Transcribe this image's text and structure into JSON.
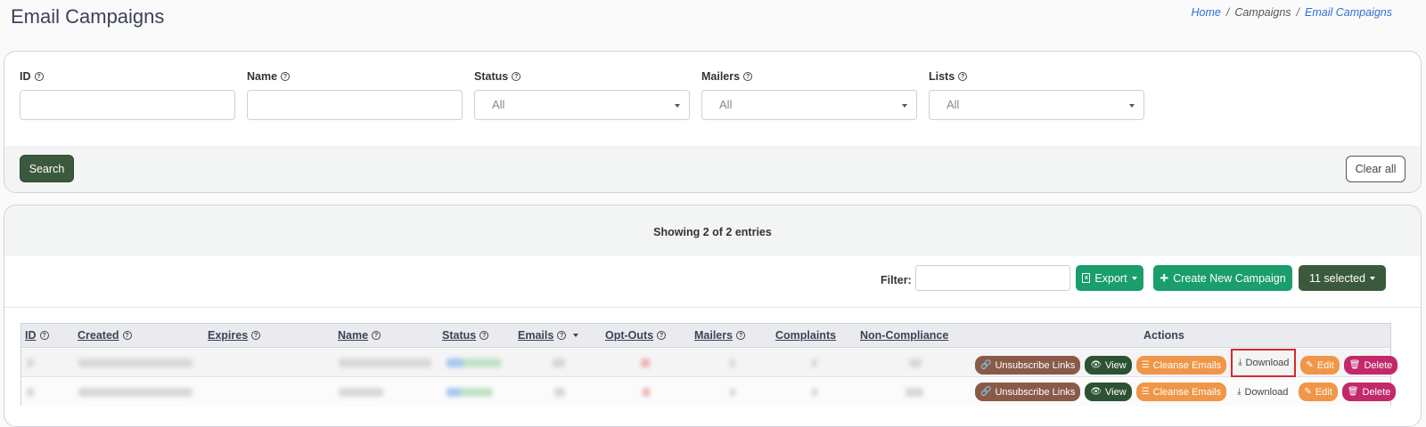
{
  "page": {
    "title": "Email Campaigns",
    "breadcrumb": [
      "Home",
      "Campaigns",
      "Email Campaigns"
    ]
  },
  "filters": {
    "fields": [
      {
        "label": "ID",
        "type": "text",
        "value": ""
      },
      {
        "label": "Name",
        "type": "text",
        "value": ""
      },
      {
        "label": "Status",
        "type": "select",
        "value": "All"
      },
      {
        "label": "Mailers",
        "type": "select",
        "value": "All"
      },
      {
        "label": "Lists",
        "type": "select",
        "value": "All"
      }
    ],
    "search_label": "Search",
    "clear_label": "Clear all"
  },
  "results": {
    "summary": "Showing 2 of 2 entries",
    "filter_label": "Filter:",
    "export_label": "Export",
    "create_label": "Create New Campaign",
    "selected_label": "11 selected",
    "columns": [
      "ID",
      "Created",
      "Expires",
      "Name",
      "Status",
      "Emails",
      "Opt-Outs",
      "Mailers",
      "Complaints",
      "Non-Compliance",
      "Actions"
    ],
    "row_actions": [
      "Unsubscribe Links",
      "View",
      "Cleanse Emails",
      "Download",
      "Edit",
      "Delete"
    ],
    "rows_count_note": 2
  },
  "colors": {
    "primary_dark_green": "#3b5a3d",
    "export_green": "#1a9e6b",
    "orange": "#f09648",
    "brown": "#8a5a49",
    "magenta": "#c2286a",
    "highlight_red": "#d42a2a",
    "link_blue": "#2f6fd6"
  }
}
